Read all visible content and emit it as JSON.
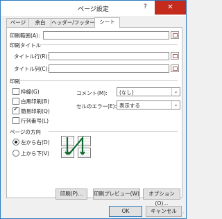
{
  "window": {
    "title": "ページ設定",
    "help": "?",
    "close": "✕"
  },
  "tabs": [
    "ページ",
    "余白",
    "ヘッダー/フッター",
    "シート"
  ],
  "print_area": {
    "label": "印刷範囲(A):",
    "value": ""
  },
  "print_titles": {
    "heading": "印刷タイトル",
    "rows_label": "タイトル行(R):",
    "cols_label": "タイトル列(C):",
    "rows_value": "",
    "cols_value": ""
  },
  "print": {
    "heading": "印刷",
    "gridlines": {
      "label": "枠線(G)",
      "checked": false
    },
    "black_white": {
      "label": "白黒印刷(B)",
      "checked": false
    },
    "draft": {
      "label": "簡易印刷(Q)",
      "checked": true
    },
    "row_col_headings": {
      "label": "行列番号(L)",
      "checked": false
    },
    "comments": {
      "label": "コメント(M):",
      "value": "(なし)"
    },
    "cell_errors": {
      "label": "セルのエラー(E):",
      "value": "表示する"
    }
  },
  "page_order": {
    "heading": "ページの方向",
    "down_then_over": {
      "label": "左から右(D)",
      "selected": true
    },
    "over_then_down": {
      "label": "上から下(V)",
      "selected": false
    }
  },
  "buttons": {
    "print": "印刷(P)...",
    "preview": "印刷プレビュー(W)",
    "options": "オプション(O)...",
    "ok": "OK",
    "cancel": "キャンセル"
  },
  "icons": {
    "range_picker": "range-selector-icon",
    "page_order_illustration": "page-order-icon",
    "dropdown": "chevron-down-icon"
  }
}
